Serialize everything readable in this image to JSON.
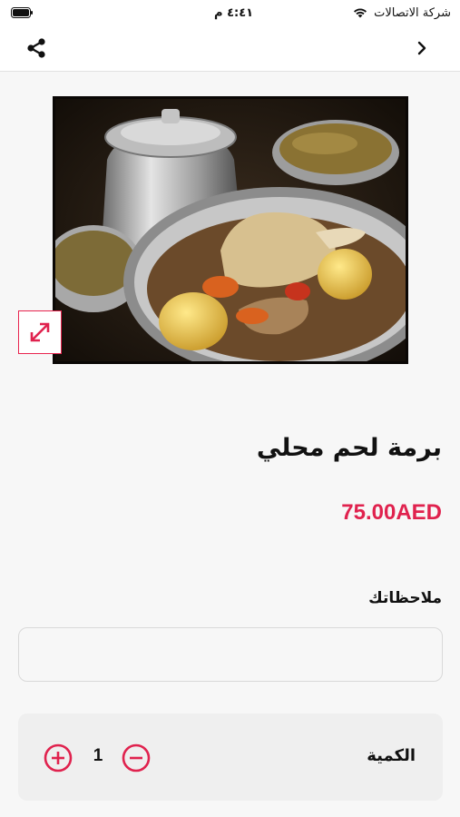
{
  "status_bar": {
    "carrier": "شركة الاتصالات",
    "time": "٤:٤١ م",
    "icons": [
      "wifi-icon",
      "battery-icon"
    ]
  },
  "nav": {
    "icons": [
      "share-icon",
      "chevron-right-icon"
    ]
  },
  "product": {
    "image_icon": "food-photo",
    "expand_icon": "expand-icon",
    "title": "برمة لحم محلي",
    "price": "75.00AED"
  },
  "notes": {
    "label": "ملاحظاتك",
    "value": ""
  },
  "quantity": {
    "label": "الكمية",
    "value": "1",
    "icons": [
      "plus-circle-icon",
      "minus-circle-icon"
    ]
  },
  "colors": {
    "accent": "#e0224e",
    "background": "#f7f7f7"
  }
}
